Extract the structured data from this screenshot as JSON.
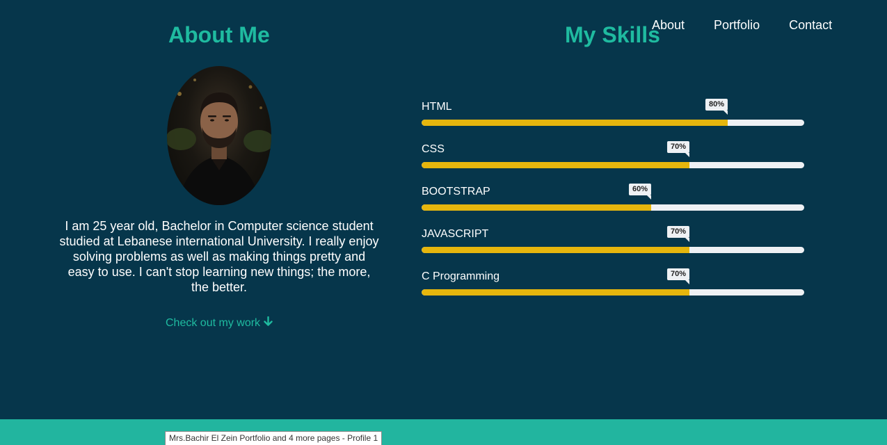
{
  "nav": {
    "items": [
      {
        "label": "About"
      },
      {
        "label": "Portfolio"
      },
      {
        "label": "Contact"
      }
    ]
  },
  "about": {
    "title": "About Me",
    "bio": "I am 25 year old, Bachelor in Computer science student studied at Lebanese international University. I really enjoy solving problems as well as making things pretty and easy to use. I can't stop learning new things; the more, the better.",
    "cta_label": "Check out my work",
    "cta_icon": "arrow-down-icon"
  },
  "skills": {
    "title": "My Skills",
    "items": [
      {
        "name": "HTML",
        "percent": 80,
        "label": "80%"
      },
      {
        "name": "CSS",
        "percent": 70,
        "label": "70%"
      },
      {
        "name": "BOOTSTRAP",
        "percent": 60,
        "label": "60%"
      },
      {
        "name": "JAVASCRIPT",
        "percent": 70,
        "label": "70%"
      },
      {
        "name": "C Programming",
        "percent": 70,
        "label": "70%"
      }
    ]
  },
  "tooltip": {
    "text": "Mrs.Bachir El Zein Portfolio and 4 more pages - Profile 1"
  },
  "colors": {
    "background": "#06364b",
    "accent": "#1fbba0",
    "bar_fill": "#e6b60d",
    "bar_track": "#eef1f4",
    "footer": "#22b59f"
  }
}
